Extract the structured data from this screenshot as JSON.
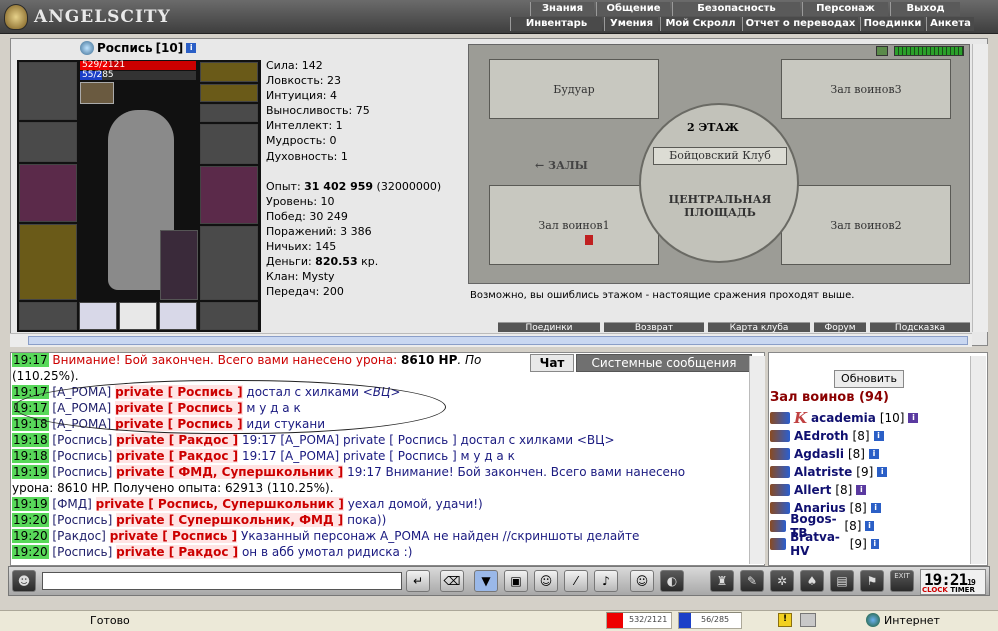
{
  "app": {
    "title": "ANGELSCITY"
  },
  "menu_top": [
    "Знания",
    "Общение",
    "Безопасность",
    "Персонаж",
    "Выход"
  ],
  "menu_sub": [
    "Инвентарь",
    "Умения",
    "Мой Скролл",
    "Отчет о переводах",
    "Поединки",
    "Анкета"
  ],
  "character": {
    "name": "Роспись",
    "level": "[10]",
    "hp_text": "529/2121",
    "mp_text": "55/285",
    "hp_fraction": 0.249,
    "mp_fraction": 0.193
  },
  "stats": {
    "strength": "Сила: 142",
    "agility": "Ловкость: 23",
    "intuition": "Интуиция: 4",
    "endurance": "Выносливость: 75",
    "intellect": "Интеллект: 1",
    "wisdom": "Мудрость: 0",
    "spirit": "Духовность: 1",
    "exp_label": "Опыт:",
    "exp_value": "31 402 959",
    "exp_next": "(32000000)",
    "level": "Уровень: 10",
    "wins": "Побед: 30 249",
    "losses": "Поражений: 3 386",
    "draws": "Ничьих: 145",
    "money_label": "Деньги:",
    "money_value": "820.53",
    "money_unit": "кр.",
    "clan": "Клан: Mysty",
    "transfers": "Передач: 200"
  },
  "map": {
    "rooms": {
      "boudoir": "Будуар",
      "hall3": "Зал воинов3",
      "floor": "2 ЭТАЖ",
      "club": "Бойцовский Клуб",
      "halls": "← ЗАЛЫ",
      "central1": "ЦЕНТРАЛЬНАЯ",
      "central2": "ПЛОЩАДЬ",
      "hall1": "Зал воинов1",
      "hall2": "Зал воинов2"
    },
    "notice": "Возможно, вы ошиблись этажом - настоящие сражения проходят выше.",
    "buttons": [
      "Поединки",
      "Возврат",
      "Карта клуба",
      "Форум",
      "Подсказка"
    ]
  },
  "chat": {
    "tabs": {
      "chat": "Чат",
      "system": "Системные сообщения"
    },
    "lines": [
      {
        "time": "19:17",
        "sender": "",
        "private": "",
        "text_pre": "Внимание! Бой закончен. Всего вами нанесено урона: ",
        "bold": "8610 HP",
        "text_post": ". По"
      },
      {
        "time": "",
        "sender": "",
        "private": "",
        "text_pre": "(110.25%).",
        "bold": "",
        "text_post": ""
      },
      {
        "time": "19:17",
        "sender": "[А_РОМА]",
        "private": "private [ Роспись ]",
        "text_pre": "достал с хилками ",
        "bold": "",
        "text_post": "<ВЦ>"
      },
      {
        "time": "19:17",
        "sender": "[А_РОМА]",
        "private": "private [ Роспись ]",
        "text_pre": "м у д а к",
        "bold": "",
        "text_post": ""
      },
      {
        "time": "19:18",
        "sender": "[А_РОМА]",
        "private": "private [ Роспись ]",
        "text_pre": "иди стукани",
        "bold": "",
        "text_post": ""
      },
      {
        "time": "19:18",
        "sender": "[Роспись]",
        "private": "private [ Ракдос ]",
        "text_pre": "19:17 [А_РОМА] private [ Роспись ] достал с хилками <ВЦ>",
        "bold": "",
        "text_post": ""
      },
      {
        "time": "19:18",
        "sender": "[Роспись]",
        "private": "private [ Ракдос ]",
        "text_pre": "19:17 [А_РОМА] private [ Роспись ] м у д а к",
        "bold": "",
        "text_post": ""
      },
      {
        "time": "19:19",
        "sender": "[Роспись]",
        "private": "private [ ФМД, Супершкольник ]",
        "text_pre": "19:17 Внимание! Бой закончен. Всего вами нанесено",
        "bold": "",
        "text_post": ""
      },
      {
        "time": "",
        "sender": "",
        "private": "",
        "text_pre": "урона: 8610 HP. Получено опыта: 62913 (110.25%).",
        "bold": "",
        "text_post": ""
      },
      {
        "time": "19:19",
        "sender": "[ФМД]",
        "private": "private [ Роспись, Супершкольник ]",
        "text_pre": "уехал домой, удачи!)",
        "bold": "",
        "text_post": ""
      },
      {
        "time": "19:20",
        "sender": "[Роспись]",
        "private": "private [ Супершкольник, ФМД ]",
        "text_pre": "пока))",
        "bold": "",
        "text_post": ""
      },
      {
        "time": "19:20",
        "sender": "[Ракдос]",
        "private": "private [ Роспись ]",
        "text_pre": "Указанный персонаж А_РОМА не найден //скриншоты делайте",
        "bold": "",
        "text_post": ""
      },
      {
        "time": "19:20",
        "sender": "[Роспись]",
        "private": "private [ Ракдос ]",
        "text_pre": "он в абб умотал ридиска :)",
        "bold": "",
        "text_post": ""
      }
    ]
  },
  "room_panel": {
    "refresh": "Обновить",
    "title": "Зал воинов (94)",
    "players": [
      {
        "name": "academia",
        "level": "[10]",
        "first": "K"
      },
      {
        "name": "AEdroth",
        "level": "[8]",
        "first": ""
      },
      {
        "name": "Agdasli",
        "level": "[8]",
        "first": ""
      },
      {
        "name": "Alatriste",
        "level": "[9]",
        "first": ""
      },
      {
        "name": "Allert",
        "level": "[8]",
        "first": ""
      },
      {
        "name": "Anarius",
        "level": "[8]",
        "first": ""
      },
      {
        "name": "Bogos-TB",
        "level": "[8]",
        "first": ""
      },
      {
        "name": "Bratva-HV",
        "level": "[9]",
        "first": ""
      }
    ]
  },
  "toolbar": {
    "clock": "19:21",
    "clock_seconds": "19",
    "clock_label_left": "CLOCK",
    "clock_label_right": "TIMER",
    "exit": "EXIT"
  },
  "statusbar": {
    "ready": "Готово",
    "hp": "532/2121",
    "mp": "56/285",
    "zone": "Интернет"
  },
  "colors": {
    "accent_green": "#58d85a",
    "private_red": "#cc0000",
    "hp_red": "#e00000",
    "mp_blue": "#1c40c8"
  }
}
